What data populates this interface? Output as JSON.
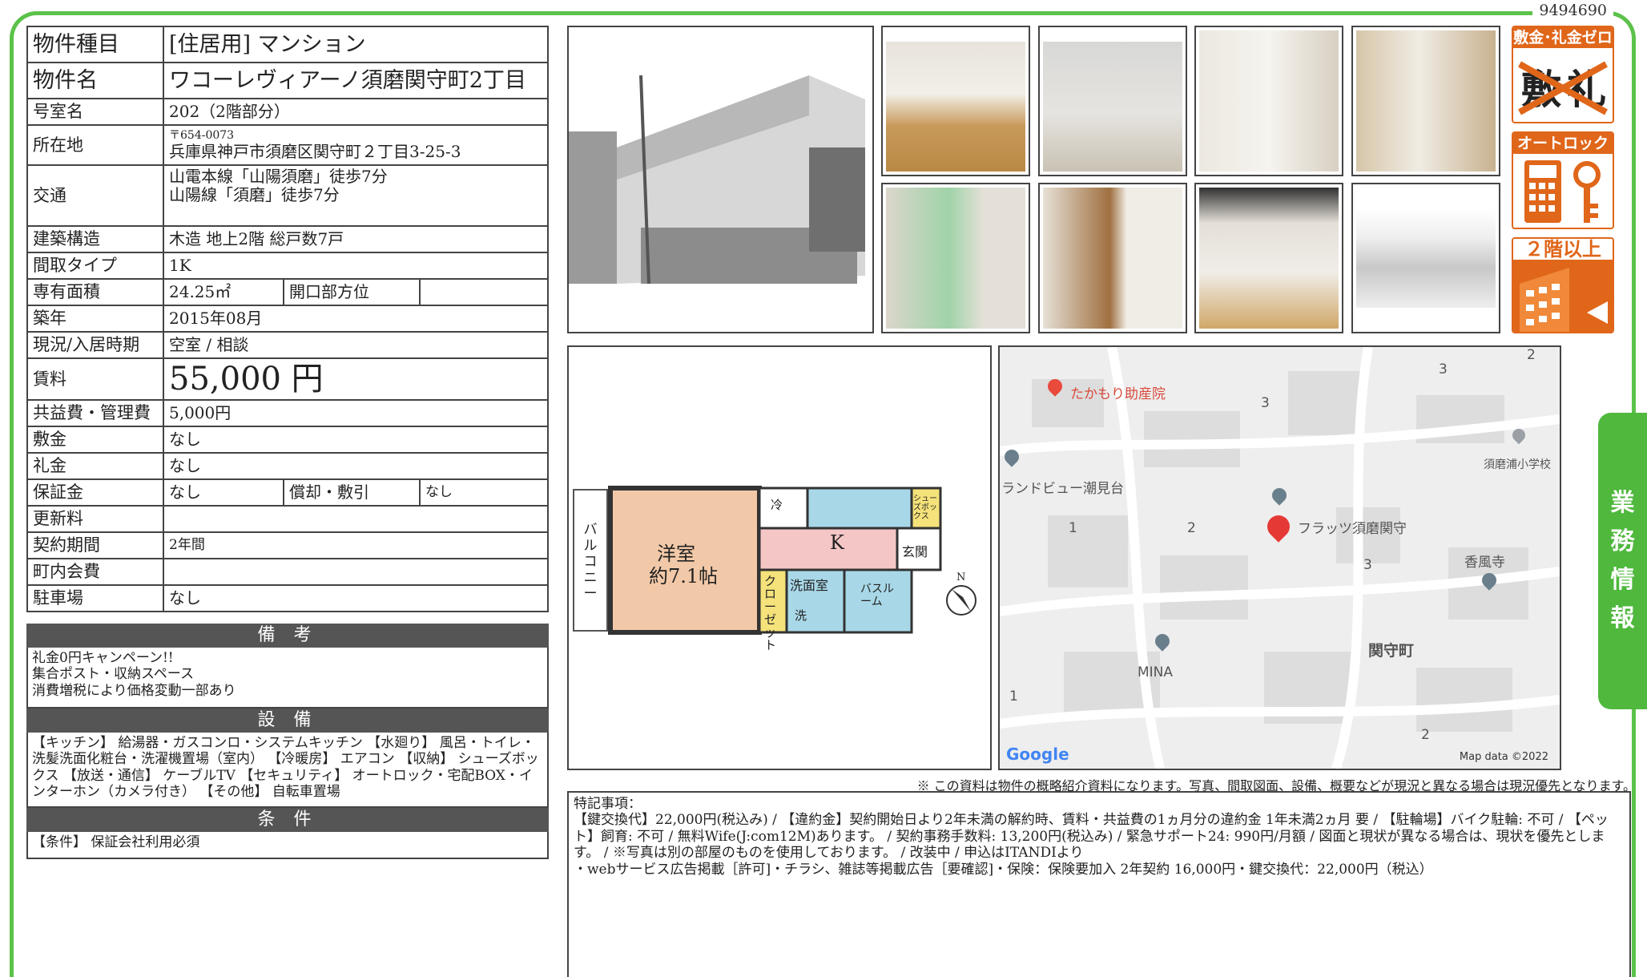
{
  "property_id": "9494690",
  "spec": {
    "type_label": "物件種目",
    "type_value": "[住居用] マンション",
    "name_label": "物件名",
    "name_value": "ワコーレヴィアーノ須磨関守町2丁目",
    "room_label": "号室名",
    "room_value": "202（2階部分）",
    "address_label": "所在地",
    "postal": "〒654-0073",
    "address": "兵庫県神戸市須磨区関守町２丁目3-25-3",
    "access_label": "交通",
    "access_1": "山電本線「山陽須磨」徒歩7分",
    "access_2": "山陽線「須磨」徒歩7分",
    "structure_label": "建築構造",
    "structure_value": "木造 地上2階 総戸数7戸",
    "layout_label": "間取タイプ",
    "layout_value": "1K",
    "area_label": "専有面積",
    "area_value": "24.25㎡",
    "direction_label": "開口部方位",
    "direction_value": "",
    "built_label": "築年",
    "built_value": "2015年08月",
    "status_label": "現況/入居時期",
    "status_value": "空室 / 相談",
    "rent_label": "賃料",
    "rent_value": "55,000 円",
    "fee_label": "共益費・管理費",
    "fee_value": "5,000円",
    "deposit_label": "敷金",
    "deposit_value": "なし",
    "key_money_label": "礼金",
    "key_money_value": "なし",
    "guarantee_label": "保証金",
    "guarantee_value": "なし",
    "amort_label": "償却・敷引",
    "amort_value": "なし",
    "renewal_label": "更新料",
    "renewal_value": "",
    "contract_label": "契約期間",
    "contract_value": "2年間",
    "assoc_label": "町内会費",
    "assoc_value": "",
    "parking_label": "駐車場",
    "parking_value": "なし"
  },
  "remarks": {
    "title": "備 考",
    "body": "礼金0円キャンペーン!!\n集合ポスト・収納スペース\n消費増税により価格変動一部あり"
  },
  "facilities": {
    "title": "設 備",
    "body": "【キッチン】 給湯器・ガスコンロ・システムキッチン 【水廻り】 風呂・トイレ・洗髪洗面化粧台・洗濯機置場（室内） 【冷暖房】 エアコン 【収納】 シューズボックス 【放送・通信】 ケーブルTV 【セキュリティ】 オートロック・宅配BOX・インターホン（カメラ付き） 【その他】 自転車置場"
  },
  "conditions": {
    "title": "条 件",
    "body": "【条件】 保証会社利用必須"
  },
  "badges": {
    "b1_title": "敷金･礼金ゼロ",
    "b1_s": "敷",
    "b1_r": "礼",
    "b2_title": "オートロック",
    "b3_title": "２階以上"
  },
  "floorplan": {
    "room": "洋室",
    "room_size": "約7.1帖",
    "balcony": "バルコニー",
    "closet": "クローゼット",
    "kitchen": "K",
    "entrance": "玄関",
    "laundry": "洗面室",
    "bath": "バスルーム",
    "fridge": "冷",
    "wash": "洗",
    "shoes": "シューズボックス",
    "north": "N"
  },
  "map": {
    "clinic": "たかもり助産院",
    "landview": "ランドビュー潮見台",
    "property": "フラッツ須磨関守",
    "school": "須磨浦小学校",
    "temple": "香風寺",
    "minna": "MINA",
    "town": "関守町",
    "blocks": [
      "2",
      "3",
      "3",
      "1",
      "2",
      "3",
      "1",
      "2"
    ],
    "google": "Google",
    "map_data": "Map data ©2022"
  },
  "disclaimer": "※ この資料は物件の概略紹介資料になります。写真、間取図面、設備、概要などが現況と異なる場合は現況優先となります。",
  "special": {
    "title": "特記事項：",
    "line1": "【鍵交換代】22,000円(税込み) / 【違約金】契約開始日より2年未満の解約時、賃料・共益費の1ヵ月分の違約金 1年未満2ヵ月 要 / 【駐輪場】バイク駐輪: 不可 / 【ペット】飼育: 不可 / 無料Wife(J:com12M)あります。 / 契約事務手数料: 13,200円(税込み) / 緊急サポート24: 990円/月額 / 図面と現状が異なる場合は、現状を優先とします。 / ※写真は別の部屋のものを使用しております。 / 改装中 / 申込はITANDIより",
    "line2": "・webサービス広告掲載［許可]・チラシ、雑誌等掲載広告［要確認]・保険：保険要加入 2年契約 16,000円・鍵交換代：22,000円（税込）"
  },
  "side_tab": [
    "業",
    "務",
    "情",
    "報"
  ]
}
